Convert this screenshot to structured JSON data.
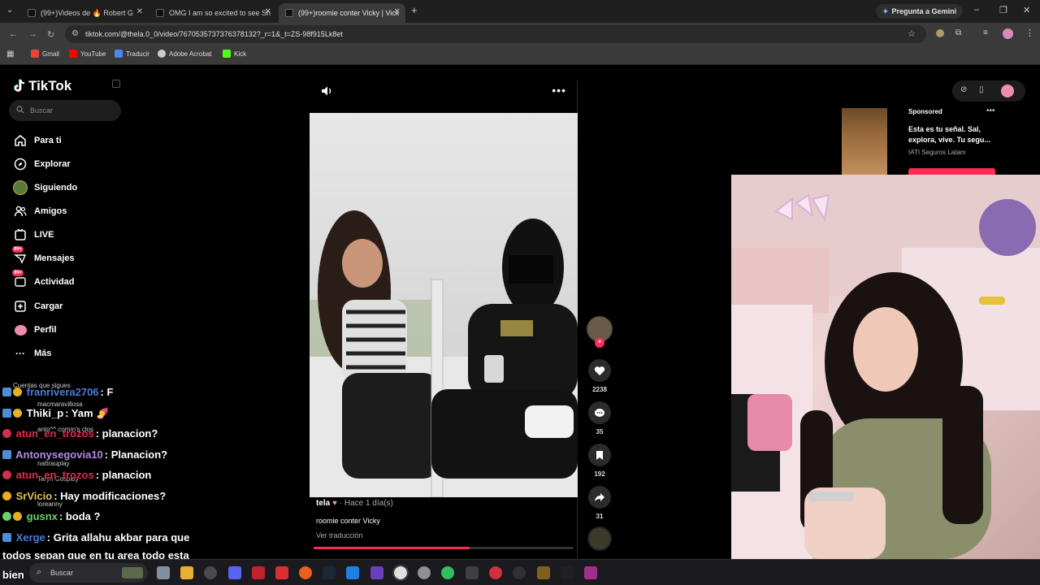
{
  "browser": {
    "tabs": [
      {
        "title": "(99+)Videos de 🔥 Robert G"
      },
      {
        "title": "OMG I am so excited to see Sh"
      },
      {
        "title": "(99+)roomie conter Vicky | Vick"
      }
    ],
    "gemini_label": "Pregunta a Gemini",
    "url": "tiktok.com/@thela.0_0/video/7670535737376378132?_r=1&_t=ZS-98f915Lk8et",
    "bookmarks": [
      "Gmail",
      "YouTube",
      "Traducir",
      "Adobe Acrobat",
      "Kick"
    ]
  },
  "tiktok": {
    "logo": "TikTok",
    "search_placeholder": "Buscar",
    "nav": [
      {
        "label": "Para ti",
        "icon": "home-icon"
      },
      {
        "label": "Explorar",
        "icon": "compass-icon"
      },
      {
        "label": "Siguiendo",
        "icon": "following-icon"
      },
      {
        "label": "Amigos",
        "icon": "friends-icon"
      },
      {
        "label": "LIVE",
        "icon": "live-icon"
      },
      {
        "label": "Mensajes",
        "icon": "messages-icon",
        "badge": "99+"
      },
      {
        "label": "Actividad",
        "icon": "activity-icon",
        "badge": "99+"
      },
      {
        "label": "Cargar",
        "icon": "upload-icon"
      },
      {
        "label": "Perfil",
        "icon": "profile-icon"
      },
      {
        "label": "Más",
        "icon": "more-icon"
      }
    ],
    "following_title": "Cuentas que sigues",
    "following": [
      "macmaravillosa",
      "anto^^ comm's clos",
      "nattrauplay",
      "Taryn Cosplay",
      "loreanny"
    ],
    "video": {
      "author": "tela",
      "time": "· Hace 1 día(s)",
      "caption": "roomie conter Vicky",
      "translate": "Ver traducción",
      "progress": 0.6
    },
    "actions": {
      "likes": "2238",
      "comments": "35",
      "saves": "192",
      "shares": "31"
    },
    "ad": {
      "label": "Sponsored",
      "text": "Esta es tu señal. Sal, explora, vive. Tu segu...",
      "brand": "IATI Seguros Latam"
    }
  },
  "chat": [
    {
      "user": "franrivera2706",
      "msg": ": F",
      "color": "#4a7bdc",
      "badge": "gold"
    },
    {
      "user": "Thiki_p",
      "msg": ": Yam 🍠",
      "color": "#ffffff",
      "badge": "gold"
    },
    {
      "user": "atun_en_trozos",
      "msg": ": planacion?",
      "color": "#d9304a",
      "badge": "red"
    },
    {
      "user": "Antonysegovia10",
      "msg": ": Planacion?",
      "color": "#b58ae0",
      "badge": "blue"
    },
    {
      "user": "atun_en_trozos",
      "msg": ": planacion",
      "color": "#d9304a",
      "badge": "red"
    },
    {
      "user": "SrVicio",
      "msg": ": Hay modificaciones?",
      "color": "#e0c050",
      "badge": "gold"
    },
    {
      "user": "gusnx",
      "msg": ": boda ?",
      "color": "#6bd06b",
      "badge": "gold"
    },
    {
      "user": "Xerge",
      "msg": ": Grita allahu akbar para que",
      "color": "#4a7bdc",
      "badge": "blue"
    },
    {
      "user": "",
      "msg": "todos sepan que en tu area todo esta",
      "color": "#ffffff",
      "badge": ""
    },
    {
      "user": "",
      "msg": "bien",
      "color": "#ffffff",
      "badge": ""
    }
  ],
  "taskbar": {
    "search_placeholder": "Buscar"
  }
}
